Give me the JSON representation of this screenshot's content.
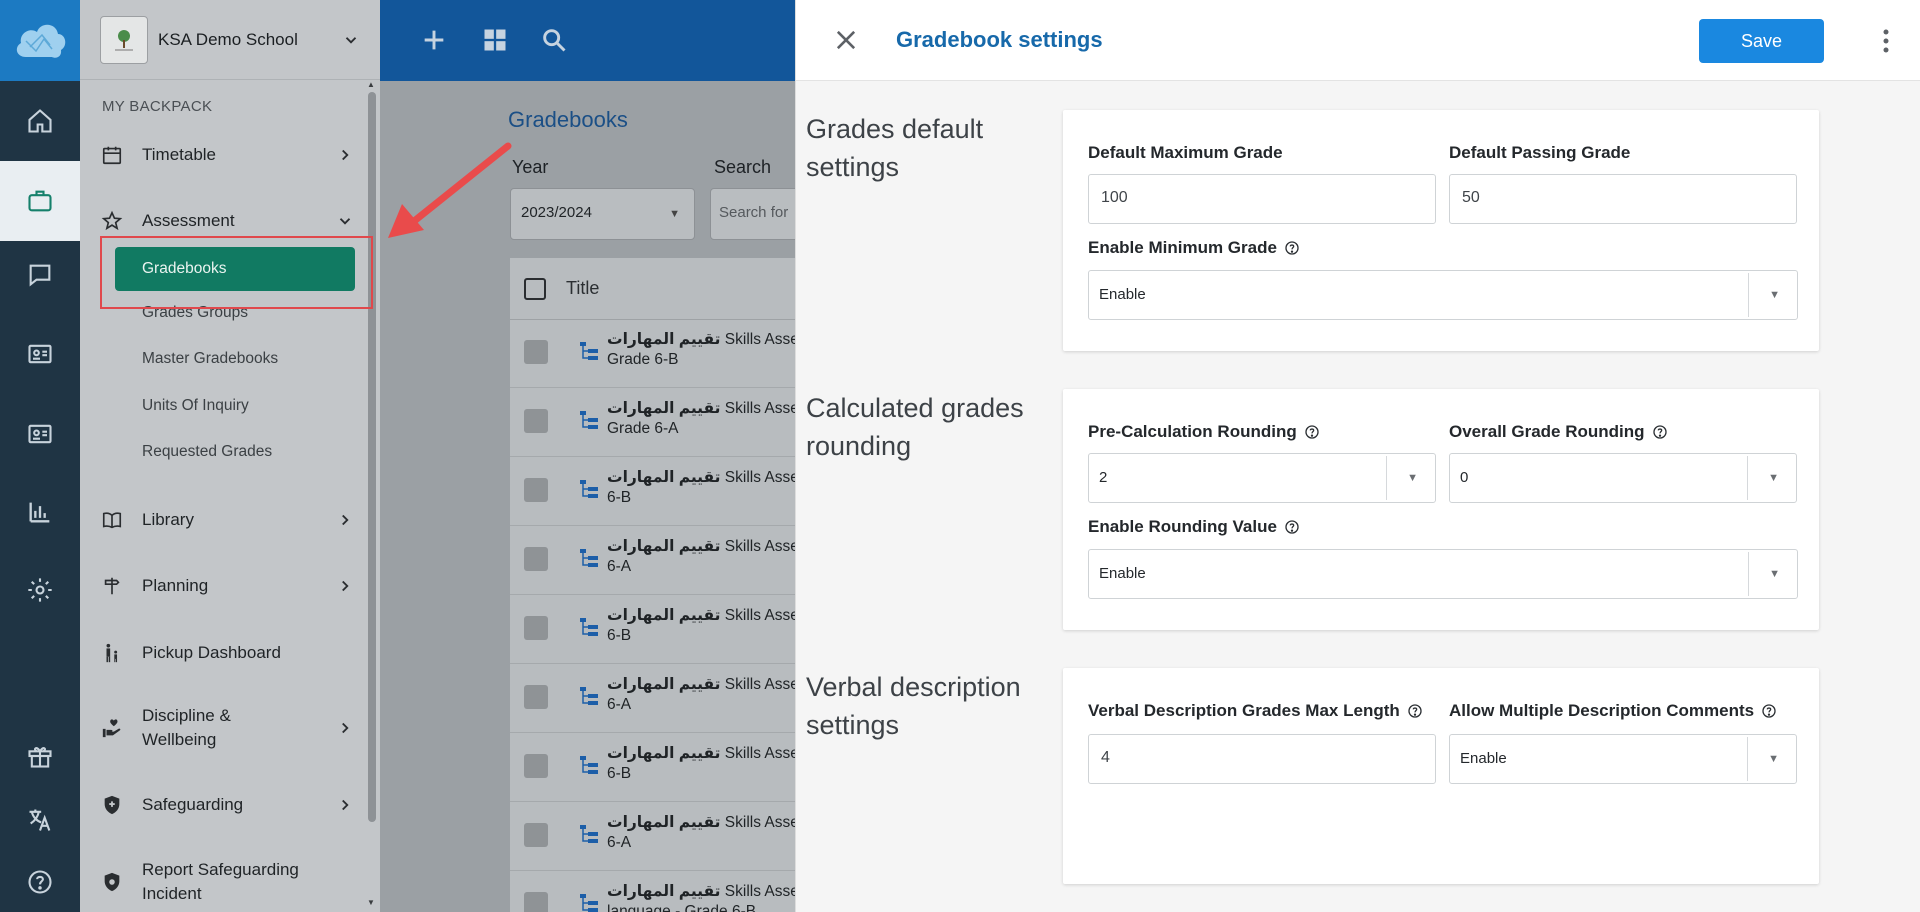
{
  "school": {
    "name": "KSA Demo School"
  },
  "sidemenu": {
    "section_title": "MY BACKPACK",
    "items": [
      {
        "label": "Timetable"
      },
      {
        "label": "Assessment"
      },
      {
        "label": "Library"
      },
      {
        "label": "Planning"
      },
      {
        "label": "Pickup Dashboard"
      },
      {
        "label": "Discipline &\nWellbeing"
      },
      {
        "label": "Safeguarding"
      },
      {
        "label": "Report Safeguarding Incident"
      }
    ],
    "assessment_sub": [
      "Gradebooks",
      "Grades Groups",
      "Master Gradebooks",
      "Units Of Inquiry",
      "Requested Grades"
    ]
  },
  "main": {
    "title": "Gradebooks",
    "year_label": "Year",
    "year_value": "2023/2024",
    "search_label": "Search",
    "search_placeholder": "Search for",
    "column_title": "Title",
    "rows": [
      {
        "ar": "تقييم المهارات",
        "en": "Skills Assessm",
        "line2": "Grade 6-B"
      },
      {
        "ar": "تقييم المهارات",
        "en": "Skills Assessm",
        "line2": "Grade 6-A"
      },
      {
        "ar": "تقييم المهارات",
        "en": "Skills Assessm",
        "line2": "6-B"
      },
      {
        "ar": "تقييم المهارات",
        "en": "Skills Assessm",
        "line2": "6-A"
      },
      {
        "ar": "تقييم المهارات",
        "en": "Skills Assessm",
        "line2": "6-B"
      },
      {
        "ar": "تقييم المهارات",
        "en": "Skills Assessm",
        "line2": "6-A"
      },
      {
        "ar": "تقييم المهارات",
        "en": "Skills Assessm",
        "line2": "6-B"
      },
      {
        "ar": "تقييم المهارات",
        "en": "Skills Assessm",
        "line2": "6-A"
      },
      {
        "ar": "تقييم المهارات",
        "en": "Skills Assessm",
        "line2": "language - Grade 6-B"
      }
    ]
  },
  "panel": {
    "title": "Gradebook settings",
    "save_label": "Save",
    "sections": {
      "defaults": {
        "title": "Grades default settings",
        "max_grade_label": "Default Maximum Grade",
        "max_grade_value": "100",
        "passing_grade_label": "Default Passing Grade",
        "passing_grade_value": "50",
        "min_grade_label": "Enable Minimum Grade",
        "min_grade_value": "Enable"
      },
      "rounding": {
        "title": "Calculated grades rounding",
        "pre_calc_label": "Pre-Calculation Rounding",
        "pre_calc_value": "2",
        "overall_label": "Overall Grade Rounding",
        "overall_value": "0",
        "enable_rounding_label": "Enable Rounding Value",
        "enable_rounding_value": "Enable"
      },
      "verbal": {
        "title": "Verbal description settings",
        "max_length_label": "Verbal Description Grades Max Length",
        "max_length_value": "4",
        "multiple_label": "Allow Multiple Description Comments",
        "multiple_value": "Enable"
      }
    }
  },
  "colors": {
    "accent_teal": "#117a62",
    "save_blue": "#1a88e0",
    "title_blue": "#1769aa",
    "highlight_red": "#e0484c"
  }
}
